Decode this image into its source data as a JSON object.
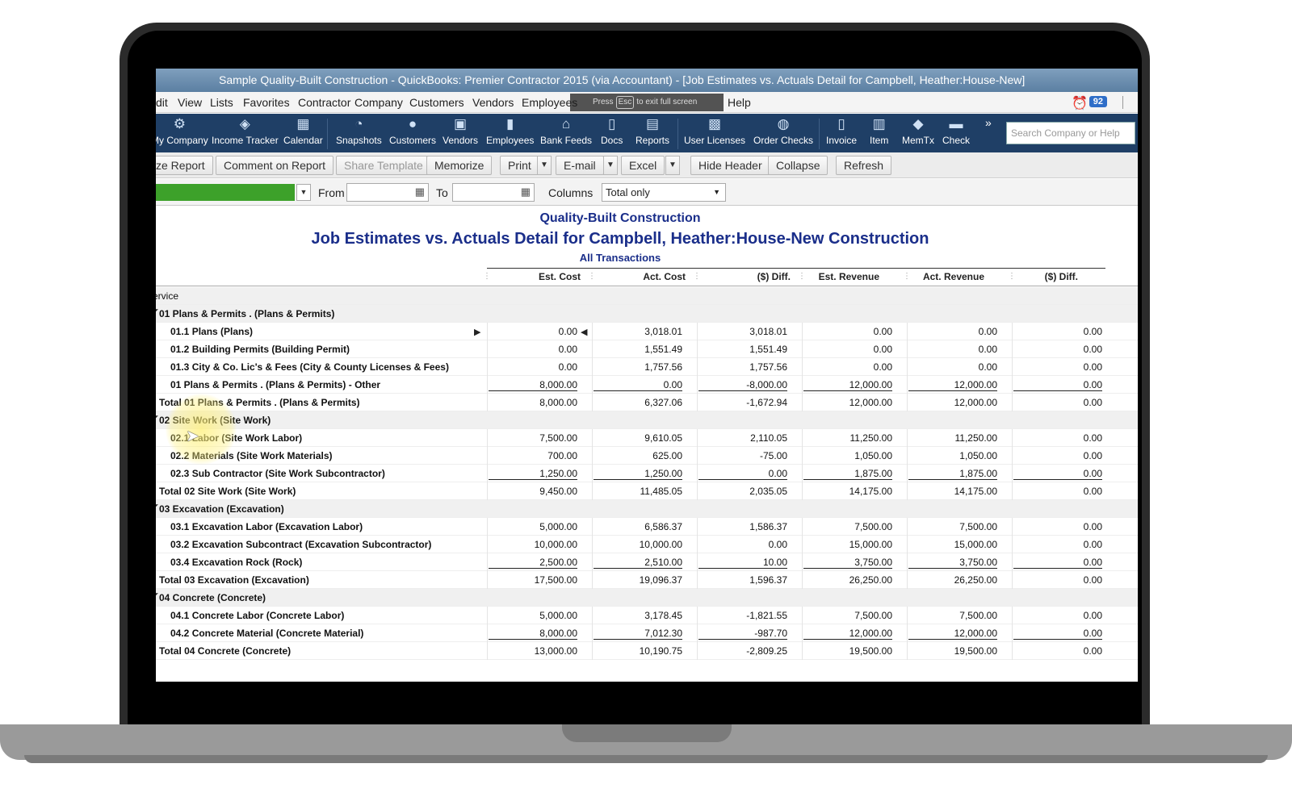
{
  "window": {
    "title": "Sample Quality-Built Construction  - QuickBooks: Premier Contractor 2015 (via Accountant)  - [Job Estimates vs. Actuals Detail for Campbell, Heather:House-New]"
  },
  "menubar": {
    "items": [
      "dit",
      "View",
      "Lists",
      "Favorites",
      "Contractor",
      "Company",
      "Customers",
      "Vendors",
      "Employees",
      "Help"
    ],
    "fullscreen_hint": {
      "press": "Press",
      "key": "Esc",
      "text": "to exit full screen"
    },
    "reminder_count": "92"
  },
  "iconbar": {
    "items": [
      {
        "label": "My Company",
        "icon": "my-company-icon"
      },
      {
        "label": "Income Tracker",
        "icon": "income-tracker-icon"
      },
      {
        "label": "Calendar",
        "icon": "calendar-icon"
      },
      {
        "label": "Snapshots",
        "icon": "snapshots-icon"
      },
      {
        "label": "Customers",
        "icon": "customers-icon"
      },
      {
        "label": "Vendors",
        "icon": "vendors-icon"
      },
      {
        "label": "Employees",
        "icon": "employees-icon"
      },
      {
        "label": "Bank Feeds",
        "icon": "bank-feeds-icon"
      },
      {
        "label": "Docs",
        "icon": "docs-icon"
      },
      {
        "label": "Reports",
        "icon": "reports-icon"
      },
      {
        "label": "User Licenses",
        "icon": "user-licenses-icon"
      },
      {
        "label": "Order Checks",
        "icon": "order-checks-icon"
      },
      {
        "label": "Invoice",
        "icon": "invoice-icon"
      },
      {
        "label": "Item",
        "icon": "item-icon"
      },
      {
        "label": "MemTx",
        "icon": "memtx-icon"
      },
      {
        "label": "Check",
        "icon": "check-icon"
      }
    ],
    "more": "»",
    "search_placeholder": "Search Company or Help"
  },
  "toolbar": {
    "customize_report": "ze Report",
    "comment_on_report": "Comment on Report",
    "share_template": "Share Template",
    "memorize": "Memorize",
    "print": "Print",
    "email": "E-mail",
    "excel": "Excel",
    "hide_header": "Hide Header",
    "collapse": "Collapse",
    "refresh": "Refresh"
  },
  "filters": {
    "from_label": "From",
    "to_label": "To",
    "columns_label": "Columns",
    "columns_value": "Total only"
  },
  "report": {
    "company": "Quality-Built Construction",
    "title": "Job Estimates vs. Actuals Detail for Campbell, Heather:House-New Construction",
    "subtitle": "All Transactions",
    "columns": [
      "Est. Cost",
      "Act. Cost",
      "($) Diff.",
      "Est. Revenue",
      "Act. Revenue",
      "($) Diff."
    ],
    "section_label": "ervice",
    "rows": [
      {
        "name": "01 Plans & Permits  . (Plans & Permits)",
        "type": "group",
        "values": []
      },
      {
        "name": "01.1 Plans (Plans)",
        "type": "item",
        "values": [
          "0.00",
          "3,018.01",
          "3,018.01",
          "0.00",
          "0.00",
          "0.00"
        ]
      },
      {
        "name": "01.2 Building Permits (Building Permit)",
        "type": "item",
        "values": [
          "0.00",
          "1,551.49",
          "1,551.49",
          "0.00",
          "0.00",
          "0.00"
        ]
      },
      {
        "name": "01.3 City & Co. Lic's & Fees (City & County Licenses & Fees)",
        "type": "item",
        "values": [
          "0.00",
          "1,757.56",
          "1,757.56",
          "0.00",
          "0.00",
          "0.00"
        ]
      },
      {
        "name": "01 Plans & Permits  . (Plans & Permits) - Other",
        "type": "item-last",
        "values": [
          "8,000.00",
          "0.00",
          "-8,000.00",
          "12,000.00",
          "12,000.00",
          "0.00"
        ]
      },
      {
        "name": "Total 01 Plans & Permits  . (Plans & Permits)",
        "type": "total",
        "values": [
          "8,000.00",
          "6,327.06",
          "-1,672.94",
          "12,000.00",
          "12,000.00",
          "0.00"
        ]
      },
      {
        "name": "02 Site Work (Site Work)",
        "type": "group",
        "values": []
      },
      {
        "name": "02.1 Labor (Site Work Labor)",
        "type": "item",
        "values": [
          "7,500.00",
          "9,610.05",
          "2,110.05",
          "11,250.00",
          "11,250.00",
          "0.00"
        ]
      },
      {
        "name": "02.2 Materials (Site Work Materials)",
        "type": "item",
        "values": [
          "700.00",
          "625.00",
          "-75.00",
          "1,050.00",
          "1,050.00",
          "0.00"
        ]
      },
      {
        "name": "02.3 Sub Contractor (Site Work Subcontractor)",
        "type": "item-last",
        "values": [
          "1,250.00",
          "1,250.00",
          "0.00",
          "1,875.00",
          "1,875.00",
          "0.00"
        ]
      },
      {
        "name": "Total 02 Site Work (Site Work)",
        "type": "total",
        "values": [
          "9,450.00",
          "11,485.05",
          "2,035.05",
          "14,175.00",
          "14,175.00",
          "0.00"
        ]
      },
      {
        "name": "03 Excavation (Excavation)",
        "type": "group",
        "values": []
      },
      {
        "name": "03.1 Excavation Labor (Excavation Labor)",
        "type": "item",
        "values": [
          "5,000.00",
          "6,586.37",
          "1,586.37",
          "7,500.00",
          "7,500.00",
          "0.00"
        ]
      },
      {
        "name": "03.2 Excavation Subcontract (Excavation Subcontractor)",
        "type": "item",
        "values": [
          "10,000.00",
          "10,000.00",
          "0.00",
          "15,000.00",
          "15,000.00",
          "0.00"
        ]
      },
      {
        "name": "03.4 Excavation Rock (Rock)",
        "type": "item-last",
        "values": [
          "2,500.00",
          "2,510.00",
          "10.00",
          "3,750.00",
          "3,750.00",
          "0.00"
        ]
      },
      {
        "name": "Total 03 Excavation (Excavation)",
        "type": "total",
        "values": [
          "17,500.00",
          "19,096.37",
          "1,596.37",
          "26,250.00",
          "26,250.00",
          "0.00"
        ]
      },
      {
        "name": "04 Concrete (Concrete)",
        "type": "group",
        "values": []
      },
      {
        "name": "04.1 Concrete Labor (Concrete Labor)",
        "type": "item",
        "values": [
          "5,000.00",
          "3,178.45",
          "-1,821.55",
          "7,500.00",
          "7,500.00",
          "0.00"
        ]
      },
      {
        "name": "04.2 Concrete Material (Concrete Material)",
        "type": "item-last",
        "values": [
          "8,000.00",
          "7,012.30",
          "-987.70",
          "12,000.00",
          "12,000.00",
          "0.00"
        ]
      },
      {
        "name": "Total 04 Concrete (Concrete)",
        "type": "total",
        "values": [
          "13,000.00",
          "10,190.75",
          "-2,809.25",
          "19,500.00",
          "19,500.00",
          "0.00"
        ]
      }
    ]
  }
}
